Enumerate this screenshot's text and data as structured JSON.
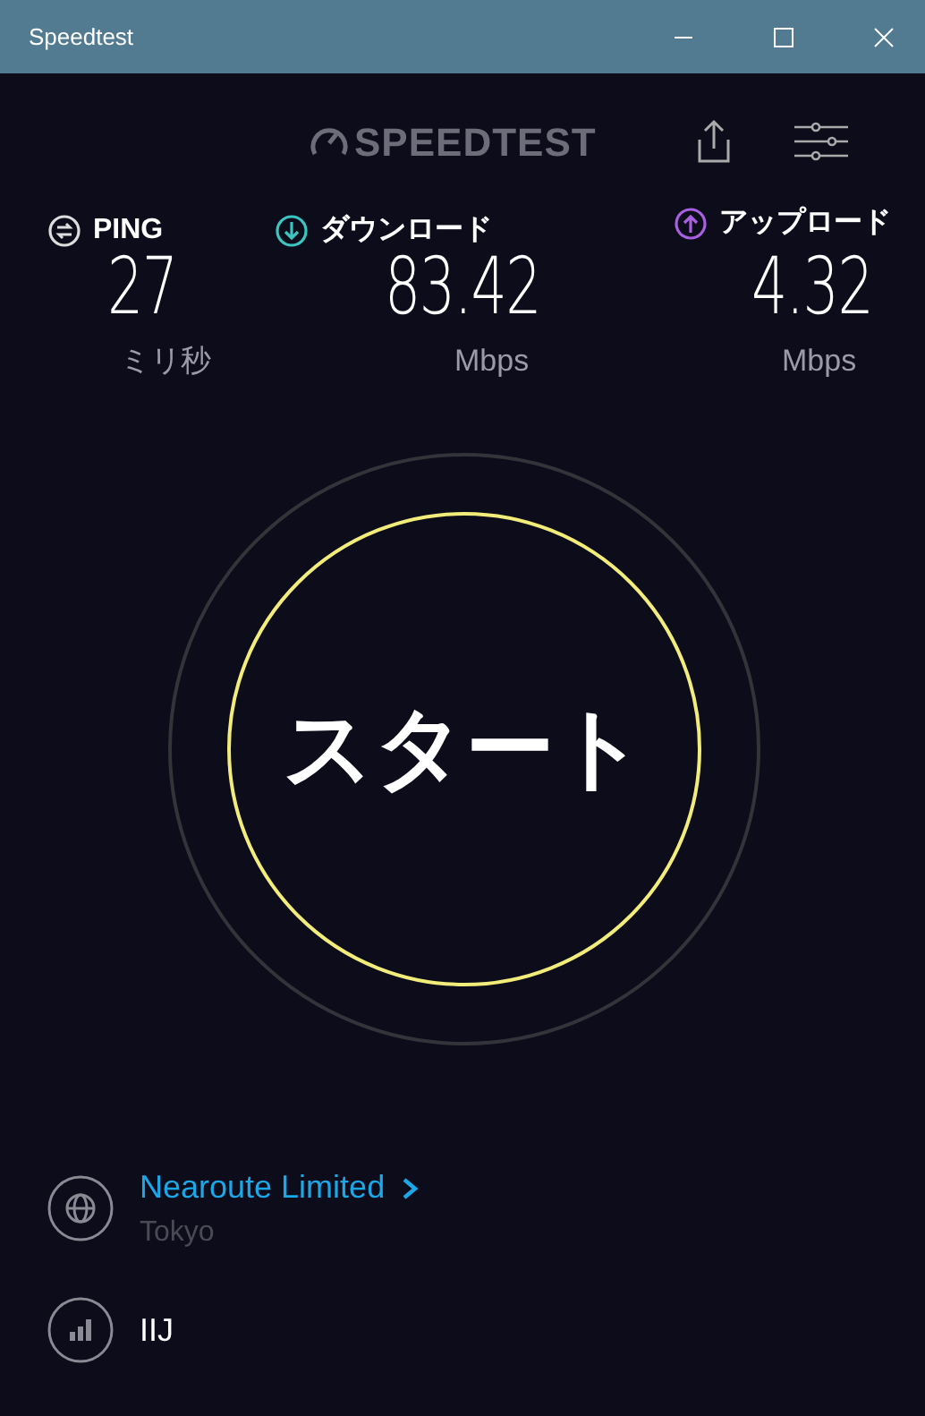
{
  "window": {
    "title": "Speedtest"
  },
  "logo": {
    "text": "SPEEDTEST"
  },
  "metrics": [
    {
      "kind": "ping",
      "label": "PING",
      "value": "27",
      "unit": "ミリ秒"
    },
    {
      "kind": "download",
      "label": "ダウンロード",
      "value": "83.42",
      "unit": "Mbps"
    },
    {
      "kind": "upload",
      "label": "アップロード",
      "value": "4.32",
      "unit": "Mbps"
    }
  ],
  "start_button": {
    "label": "スタート"
  },
  "server": {
    "name": "Nearoute Limited",
    "location": "Tokyo"
  },
  "provider": {
    "name": "IIJ"
  }
}
